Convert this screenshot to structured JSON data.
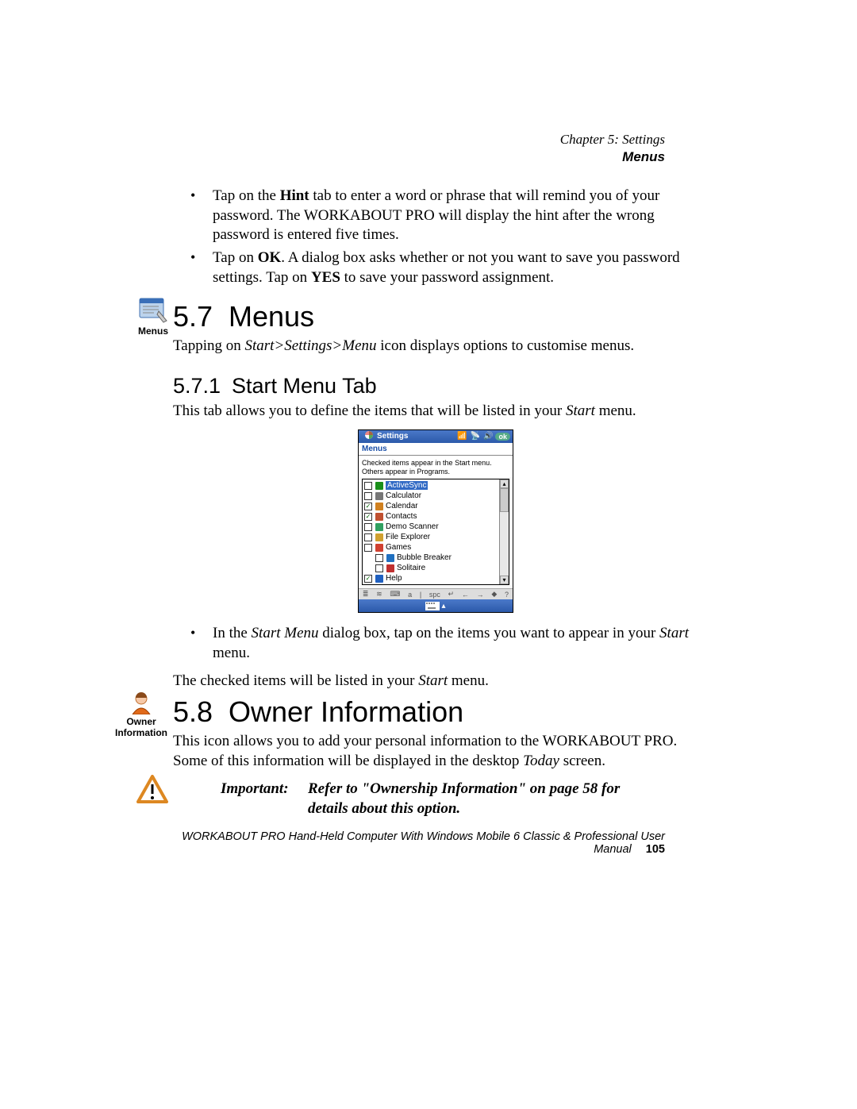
{
  "header": {
    "chapter": "Chapter 5:  Settings",
    "section": "Menus"
  },
  "intro_bullets": [
    {
      "parts": [
        {
          "t": "Tap on the "
        },
        {
          "t": "Hint",
          "b": true
        },
        {
          "t": " tab to enter a word or phrase that will remind you of your password. The WORKABOUT PRO will display the hint after the wrong password is entered five times."
        }
      ]
    },
    {
      "parts": [
        {
          "t": "Tap on "
        },
        {
          "t": "OK",
          "b": true
        },
        {
          "t": ". A dialog box asks whether or not you want to save you password settings. Tap on "
        },
        {
          "t": "YES",
          "b": true
        },
        {
          "t": " to save your password assignment."
        }
      ]
    }
  ],
  "s57": {
    "num": "5.7",
    "title": "Menus",
    "icon_label": "Menus",
    "intro_parts": [
      {
        "t": "Tapping on "
      },
      {
        "t": "Start>Settings>Menu",
        "i": true
      },
      {
        "t": " icon displays options to customise menus."
      }
    ]
  },
  "s571": {
    "num": "5.7.1",
    "title": "Start Menu Tab",
    "intro_parts": [
      {
        "t": "This tab allows you to define the items that will be listed in your "
      },
      {
        "t": "Start",
        "i": true
      },
      {
        "t": " menu."
      }
    ],
    "bullet_parts": [
      {
        "t": "In the "
      },
      {
        "t": "Start Menu",
        "i": true
      },
      {
        "t": " dialog box, tap on the items you want to appear in your "
      },
      {
        "t": "Start",
        "i": true
      },
      {
        "t": " menu."
      }
    ],
    "outro_parts": [
      {
        "t": "The checked items will be listed in your "
      },
      {
        "t": "Start",
        "i": true
      },
      {
        "t": " menu."
      }
    ]
  },
  "screenshot": {
    "title": "Settings",
    "ok": "ok",
    "tab": "Menus",
    "help_text": "Checked items appear in the Start menu. Others appear in Programs.",
    "items": [
      {
        "label": "ActiveSync",
        "checked": false,
        "selected": true,
        "color": "#1a8f1a"
      },
      {
        "label": "Calculator",
        "checked": false,
        "color": "#777"
      },
      {
        "label": "Calendar",
        "checked": true,
        "color": "#d08020"
      },
      {
        "label": "Contacts",
        "checked": true,
        "color": "#c05030"
      },
      {
        "label": "Demo Scanner",
        "checked": false,
        "color": "#30a060"
      },
      {
        "label": "File Explorer",
        "checked": false,
        "color": "#d0a030"
      },
      {
        "label": "Games",
        "checked": false,
        "color": "#d04030"
      },
      {
        "label": "Bubble Breaker",
        "checked": false,
        "indent": true,
        "color": "#2070c0"
      },
      {
        "label": "Solitaire",
        "checked": false,
        "indent": true,
        "color": "#c03030"
      },
      {
        "label": "Help",
        "checked": true,
        "color": "#2060c0"
      }
    ],
    "keys": [
      "≣",
      "≋",
      "⌨",
      "a",
      "|",
      "spc",
      "↵",
      "←",
      "→",
      "◆",
      "?"
    ]
  },
  "s58": {
    "num": "5.8",
    "title": "Owner Information",
    "icon_label1": "Owner",
    "icon_label2": "Information",
    "intro_parts": [
      {
        "t": "This icon allows you to add your personal information to the WORKABOUT PRO. Some of this information will be displayed in the desktop "
      },
      {
        "t": "Today",
        "i": true
      },
      {
        "t": " screen."
      }
    ]
  },
  "important": {
    "label": "Important:",
    "text": "Refer to \"Ownership Information\" on page 58 for details about this option."
  },
  "footer": {
    "text": "WORKABOUT PRO Hand-Held Computer With Windows Mobile 6 Classic & Professional User Manual",
    "page": "105"
  }
}
